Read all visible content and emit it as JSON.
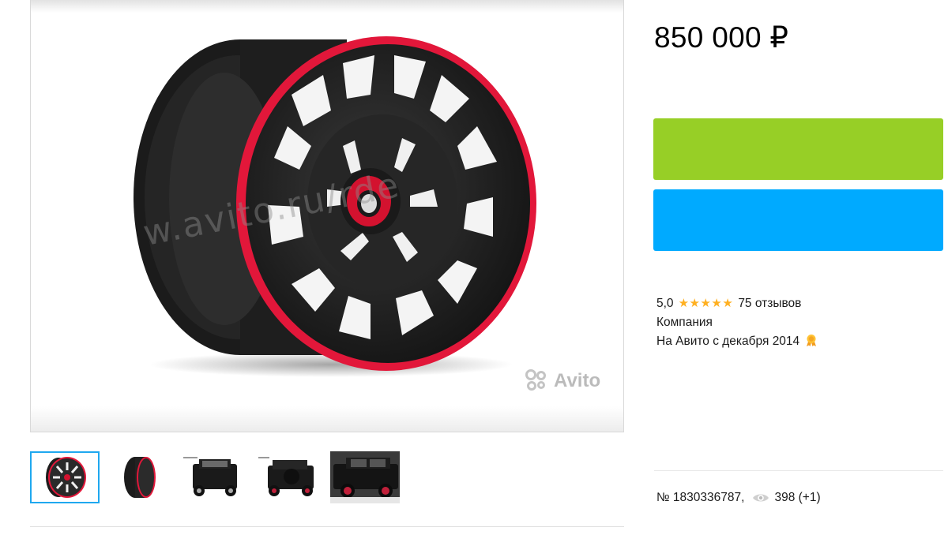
{
  "listing": {
    "price": "850 000 ₽",
    "watermark_text": "w.avito.ru/rde",
    "brand_mark": "Avito"
  },
  "gallery": {
    "thumbnails": [
      {
        "subject": "wheel-front",
        "active": true
      },
      {
        "subject": "wheel-side",
        "active": false
      },
      {
        "subject": "suv-front",
        "active": false
      },
      {
        "subject": "suv-rear",
        "active": false
      },
      {
        "subject": "suv-side",
        "active": false
      }
    ]
  },
  "buttons": {
    "show_phone_color": "#97cf26",
    "write_message_color": "#00aaff"
  },
  "seller": {
    "rating": "5,0",
    "stars": "★★★★★",
    "reviews": "75 отзывов",
    "type": "Компания",
    "since": "На Авито с декабря 2014"
  },
  "meta": {
    "item_number": "№ 1830336787,",
    "views": "398 (+1)"
  },
  "colors": {
    "accent_blue": "#00aaff",
    "accent_green": "#97cf26",
    "star": "#ffb021",
    "rim_red": "#e2173a"
  }
}
